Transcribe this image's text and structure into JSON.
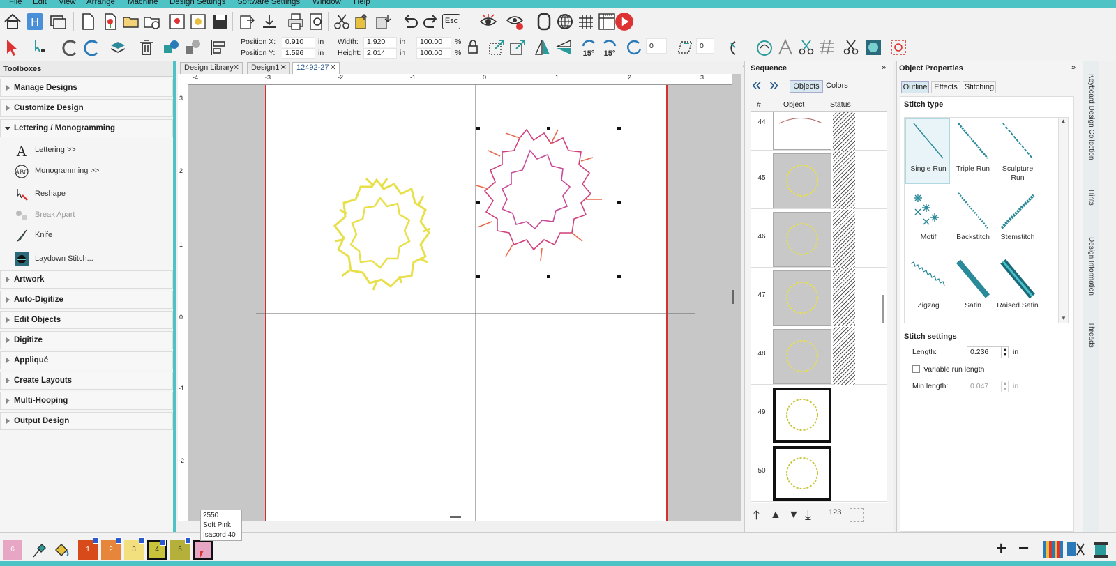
{
  "menu": [
    "File",
    "Edit",
    "View",
    "Arrange",
    "Machine",
    "Design Settings",
    "Software Settings",
    "Window",
    "Help"
  ],
  "fields": {
    "pos_x_label": "Position X:",
    "pos_x": "0.910",
    "pos_y_label": "Position Y:",
    "pos_y": "1.596",
    "width_label": "Width:",
    "width": "1.920",
    "height_label": "Height:",
    "height": "2.014",
    "unit": "in",
    "pct_w": "100.00",
    "pct_h": "100.00",
    "pct": "%",
    "rot1": "0",
    "rot2": "0",
    "deg15a": "15°",
    "deg15b": "15°",
    "esc": "Esc"
  },
  "toolbox": {
    "title": "Toolboxes",
    "sections_top": [
      "Manage Designs",
      "Customize Design",
      "Lettering / Monogramming"
    ],
    "tools": [
      {
        "label": "Lettering >>",
        "disabled": false
      },
      {
        "label": "Monogramming >>",
        "disabled": false
      },
      {
        "label": "Reshape",
        "disabled": false
      },
      {
        "label": "Break Apart",
        "disabled": true
      },
      {
        "label": "Knife",
        "disabled": false
      },
      {
        "label": "Laydown Stitch...",
        "disabled": false
      }
    ],
    "sections_bottom": [
      "Artwork",
      "Auto-Digitize",
      "Edit Objects",
      "Digitize",
      "Appliqué",
      "Create Layouts",
      "Multi-Hooping",
      "Output Design"
    ]
  },
  "tabs": [
    "Design Library",
    "Design1",
    "12492-27"
  ],
  "ruler": {
    "top": [
      "-4",
      "-3",
      "-2",
      "-1",
      "0",
      "1",
      "2",
      "3"
    ],
    "left": [
      "3",
      "2",
      "1",
      "0",
      "-1",
      "-2"
    ]
  },
  "sequence": {
    "title": "Sequence",
    "tab_objects": "Objects",
    "tab_colors": "Colors",
    "col_num": "#",
    "col_object": "Object",
    "col_status": "Status",
    "rows": [
      "44",
      "45",
      "46",
      "47",
      "48",
      "49",
      "50"
    ],
    "bottom_count": "123"
  },
  "props": {
    "title": "Object Properties",
    "tabs": [
      "Outline",
      "Effects",
      "Stitching"
    ],
    "stitch_type_label": "Stitch type",
    "stitch_types": [
      "Single Run",
      "Triple Run",
      "Sculpture Run",
      "Motif",
      "Backstitch",
      "Stemstitch",
      "Zigzag",
      "Satin",
      "Raised Satin"
    ],
    "stitch_settings_label": "Stitch settings",
    "length_label": "Length:",
    "length": "0.236",
    "length_unit": "in",
    "variable_label": "Variable run length",
    "min_length_label": "Min length:",
    "min_length": "0.047",
    "min_unit": "in"
  },
  "right_tabs": [
    "Keyboard Design Collection",
    "Hints",
    "Design Information",
    "Threads"
  ],
  "colors": {
    "accent": "#4ec3c6",
    "hoop_line": "#d53030",
    "yellow": "#e8e04a",
    "pink": "#d0407a"
  },
  "palette": [
    {
      "label": "6",
      "color": "#e7a7c4"
    },
    {
      "label": "1",
      "color": "#d94a1a"
    },
    {
      "label": "2",
      "color": "#e7853a"
    },
    {
      "label": "3",
      "color": "#f2df7d"
    },
    {
      "label": "4",
      "color": "#c9c43a"
    },
    {
      "label": "5",
      "color": "#b5b03a"
    },
    {
      "label": "",
      "color": "#e7a7c4"
    }
  ],
  "tooltip": {
    "line1": "2550",
    "line2": "Soft Pink",
    "line3": "Isacord 40"
  }
}
